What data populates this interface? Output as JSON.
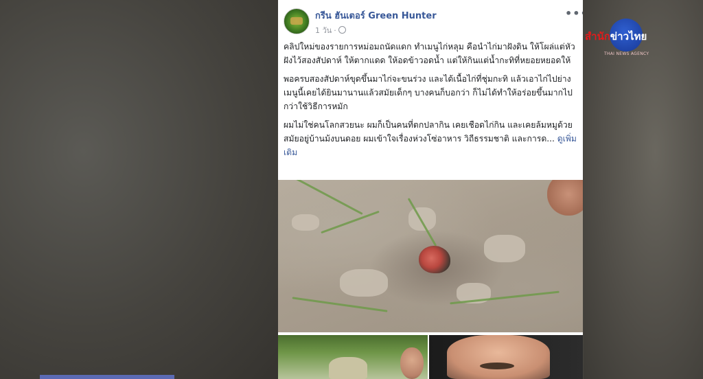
{
  "post": {
    "author": "กรีน ฮันเตอร์ Green Hunter",
    "time": "1 วัน",
    "more_label": "•••",
    "paragraphs": [
      "คลิปใหม่ของรายการหม่อมถนัดแดก ทำเมนูไก่หลุม คือนำไก่มาฝังดิน ให้โผล่แต่หัว ฝังไว้สองสัปดาห์ ให้ตากแดด ให้อดข้าวอดน้ำ แต่ให้กินแต่น้ำกะทิที่หยอยหยอดให้",
      "พอครบสองสัปดาห์ขุดขึ้นมาไก่จะขนร่วง และได้เนื้อไก่ที่ชุ่มกะทิ แล้วเอาไก่ไปย่าง เมนูนี้เคยได้ยินมานานแล้วสมัยเด็กๆ บางคนก็บอกว่า ก็ไม่ได้ทำให้อร่อยขึ้นมากไปกว่าใช้วิธีการหมัก"
    ],
    "paragraph3": "ผมไม่ใช่คนโลกสวยนะ ผมก็เป็นคนที่ตกปลากิน เคยเชือดไก่กิน และเคยล้มหมูด้วยสมัยอยู่บ้านม้งบนดอย ผมเข้าใจเรื่องห่วงโซ่อาหาร วิถีธรรมชาติ และการด...",
    "see_more": "ดูเพิ่มเติม"
  },
  "logo": {
    "text_red": "สำนัก",
    "text_white": "ข่าวไทย",
    "subtitle": "THAI NEWS AGENCY"
  },
  "colors": {
    "link_blue": "#385898",
    "logo_blue": "#1f44a8",
    "logo_red": "#e21b1b"
  }
}
